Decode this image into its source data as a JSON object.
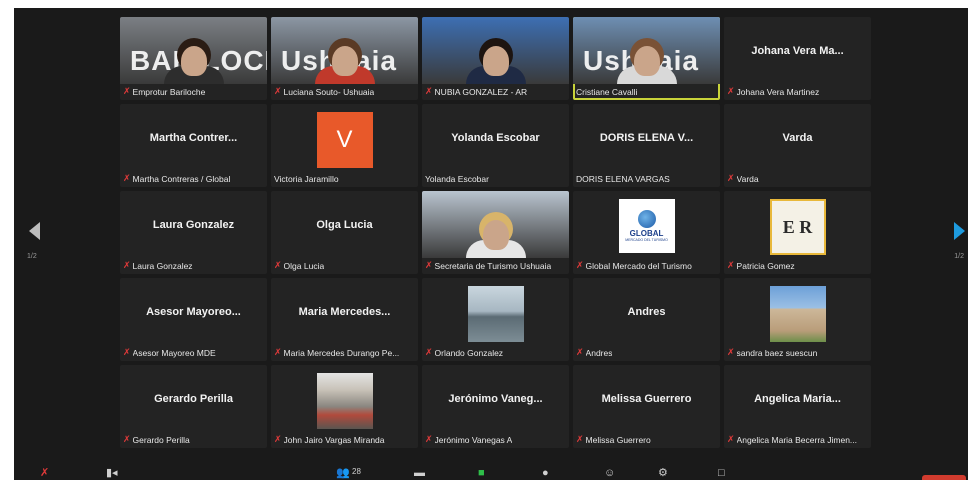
{
  "pagination": {
    "left": "1/2",
    "right": "1/2"
  },
  "participants": [
    {
      "label": "Emprotur Bariloche",
      "muted": true,
      "video": true,
      "sign_text": "BARILOCH",
      "hair": "#2a1c14",
      "bg": "#7b7f84",
      "shirt": "#2d2d2d"
    },
    {
      "label": "Luciana Souto- Ushuaia",
      "muted": true,
      "video": true,
      "sign_text": "Ushuaia",
      "hair": "#5a3a25",
      "bg": "#8c97a4",
      "shirt": "#c0392b"
    },
    {
      "label": "NUBIA GONZALEZ - AR",
      "muted": true,
      "video": true,
      "sign_text": "",
      "hair": "#1d1410",
      "bg": "#3d6fb3",
      "shirt": "#1f2a44"
    },
    {
      "label": "Cristiane Cavalli",
      "muted": false,
      "video": true,
      "speaking": true,
      "sign_text": "Ushuaia",
      "hair": "#7a5236",
      "bg": "#6e8fb3",
      "shirt": "#d9d9d9"
    },
    {
      "label": "Johana Vera Martinez",
      "name": "Johana Vera Ma...",
      "muted": true,
      "video": false
    },
    {
      "label": "Martha Contreras / Global",
      "name": "Martha Contrer...",
      "muted": true,
      "video": false
    },
    {
      "label": "Victoria Jaramillo",
      "muted": false,
      "video": false,
      "avatar_letter": "V",
      "avatar_color": "#e8592a"
    },
    {
      "label": "Yolanda Escobar",
      "name": "Yolanda Escobar",
      "muted": false,
      "video": false
    },
    {
      "label": "DORIS ELENA VARGAS",
      "name": "DORIS ELENA V...",
      "muted": false,
      "video": false
    },
    {
      "label": "Varda",
      "name": "Varda",
      "muted": true,
      "video": false
    },
    {
      "label": "Laura Gonzalez",
      "name": "Laura Gonzalez",
      "muted": true,
      "video": false
    },
    {
      "label": "Olga Lucia",
      "name": "Olga Lucia",
      "muted": true,
      "video": false
    },
    {
      "label": "Secretaria de Turismo Ushuaia",
      "muted": true,
      "video": true,
      "sign_text": "",
      "hair": "#d8b46a",
      "bg": "#b9c4cf",
      "shirt": "#e6e6e6"
    },
    {
      "label": "Global Mercado del Turismo",
      "muted": true,
      "video": false,
      "logo": "global",
      "logo_text": "GLOBAL",
      "logo_sub": "MERCADO DEL TURISMO"
    },
    {
      "label": "Patricia Gomez",
      "muted": true,
      "video": false,
      "logo": "er",
      "logo_text": "E R"
    },
    {
      "label": "Asesor Mayoreo MDE",
      "name": "Asesor Mayoreo...",
      "muted": true,
      "video": false
    },
    {
      "label": "Maria Mercedes Durango Pe...",
      "name": "Maria Mercedes...",
      "muted": true,
      "video": false
    },
    {
      "label": "Orlando Gonzalez",
      "muted": true,
      "video": false,
      "photo": "lake"
    },
    {
      "label": "Andres",
      "name": "Andres",
      "muted": true,
      "video": false
    },
    {
      "label": "sandra baez suescun",
      "muted": true,
      "video": false,
      "photo": "castle"
    },
    {
      "label": "Gerardo Perilla",
      "name": "Gerardo Perilla",
      "muted": true,
      "video": false
    },
    {
      "label": "John Jairo Vargas Miranda",
      "muted": true,
      "video": false,
      "photo": "street"
    },
    {
      "label": "Jerónimo Vanegas A",
      "name": "Jerónimo Vaneg...",
      "muted": true,
      "video": false
    },
    {
      "label": "Melissa Guerrero",
      "name": "Melissa Guerrero",
      "muted": true,
      "video": false
    },
    {
      "label": "Angelica Maria Becerra Jimen...",
      "name": "Angelica Maria...",
      "muted": true,
      "video": false
    }
  ],
  "toolbar": {
    "participants_count": "28"
  },
  "colors": {
    "background": "#1a1a1a",
    "tile": "#232323",
    "muted_icon": "#e03a3a",
    "active_speaker": "#c9d33a",
    "end_button": "#d13b2e"
  }
}
